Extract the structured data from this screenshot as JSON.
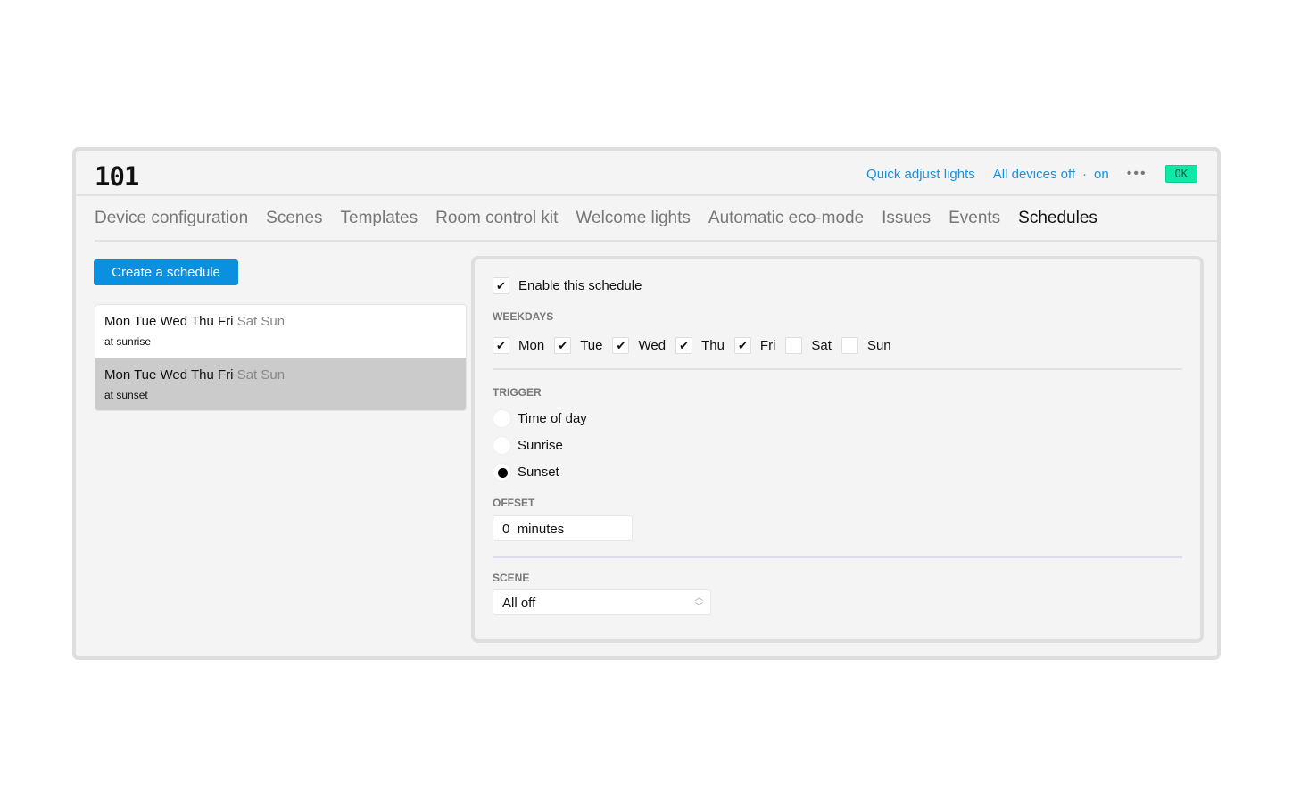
{
  "header": {
    "title": "101",
    "quick_adjust": "Quick adjust lights",
    "all_devices_off": "All devices off",
    "separator": "·",
    "on": "on",
    "more": "•••",
    "status": "OK"
  },
  "tabs": [
    "Device configuration",
    "Scenes",
    "Templates",
    "Room control kit",
    "Welcome lights",
    "Automatic eco-mode",
    "Issues",
    "Events",
    "Schedules"
  ],
  "active_tab": "Schedules",
  "create_label": "Create a schedule",
  "schedules": [
    {
      "active_days": "Mon Tue Wed Thu Fri",
      "inactive_days": "Sat Sun",
      "trigger": "at sunrise"
    },
    {
      "active_days": "Mon Tue Wed Thu Fri",
      "inactive_days": "Sat Sun",
      "trigger": "at sunset"
    }
  ],
  "editor": {
    "enable_label": "Enable this schedule",
    "weekdays_label": "WEEKDAYS",
    "weekdays": [
      {
        "label": "Mon",
        "checked": true
      },
      {
        "label": "Tue",
        "checked": true
      },
      {
        "label": "Wed",
        "checked": true
      },
      {
        "label": "Thu",
        "checked": true
      },
      {
        "label": "Fri",
        "checked": true
      },
      {
        "label": "Sat",
        "checked": false
      },
      {
        "label": "Sun",
        "checked": false
      }
    ],
    "trigger_label": "TRIGGER",
    "triggers": [
      "Time of day",
      "Sunrise",
      "Sunset"
    ],
    "selected_trigger": "Sunset",
    "offset_label": "OFFSET",
    "offset_value": "0",
    "offset_unit": "minutes",
    "scene_label": "SCENE",
    "scene_value": "All off"
  }
}
